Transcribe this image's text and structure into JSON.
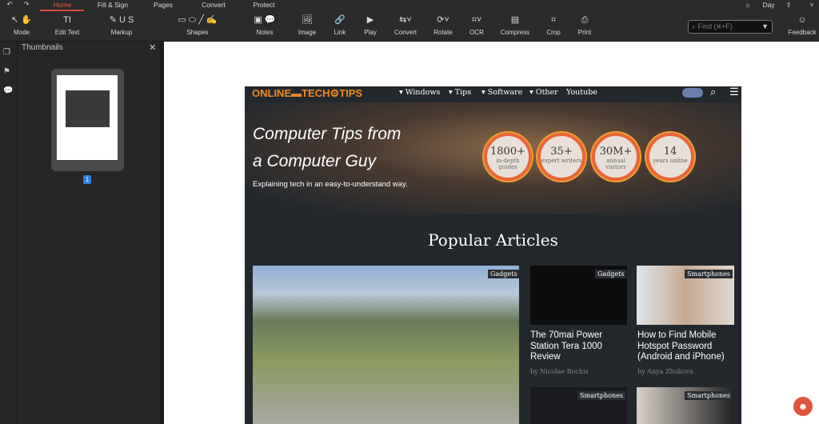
{
  "menu": {
    "tabs": [
      "Home",
      "Fill & Sign",
      "Pages",
      "Convert",
      "Protect"
    ],
    "active": "Home",
    "theme": "Day"
  },
  "toolbar": {
    "tools": [
      {
        "label": "Mode",
        "icon": "↖ ✋"
      },
      {
        "label": "Edit Text",
        "icon": "TI"
      },
      {
        "label": "Markup",
        "icon": "✎ U S"
      },
      {
        "label": "Shapes",
        "icon": "▭ ⬭ ╱ ✍"
      },
      {
        "label": "Notes",
        "icon": "▣ 💬"
      },
      {
        "label": "Image",
        "icon": "🖼"
      },
      {
        "label": "Link",
        "icon": "🔗"
      },
      {
        "label": "Play",
        "icon": "▶"
      },
      {
        "label": "Convert",
        "icon": "⇆˅"
      },
      {
        "label": "Rotate",
        "icon": "⟳˅"
      },
      {
        "label": "OCR",
        "icon": "⌗˅"
      },
      {
        "label": "Compress",
        "icon": "▤"
      },
      {
        "label": "Crop",
        "icon": "⌗"
      },
      {
        "label": "Print",
        "icon": "⎙"
      }
    ],
    "find_placeholder": "Find (⌘+F)",
    "feedback": "Feedback"
  },
  "sidebar": {
    "title": "Thumbnails",
    "page_number": "1"
  },
  "site": {
    "logo": "ONLINE▬TECH⚙TIPS",
    "nav": [
      "▾ Windows",
      "▾ Tips",
      "▾ Software",
      "▾ Other",
      "Youtube"
    ],
    "hero_line1": "Computer Tips from",
    "hero_line2": "a Computer Guy",
    "tagline": "Explaining tech in an easy-to-understand way.",
    "stats": [
      {
        "n": "1800+",
        "t": "in-depth guides"
      },
      {
        "n": "35+",
        "t": "expert writers"
      },
      {
        "n": "30M+",
        "t": "annual visitors"
      },
      {
        "n": "14",
        "t": "years online"
      }
    ],
    "section": "Popular Articles",
    "articles": [
      {
        "category": "Gadgets"
      },
      {
        "category": "Gadgets",
        "title": "The 70mai Power Station Tera 1000 Review",
        "author": "by Nicolae Bochis"
      },
      {
        "category": "Smartphones",
        "title": "How to Find Mobile Hotspot Password (Android and iPhone)",
        "author": "by Anya Zhukova"
      },
      {
        "category": "Smartphones"
      },
      {
        "category": "Smartphones"
      }
    ]
  }
}
